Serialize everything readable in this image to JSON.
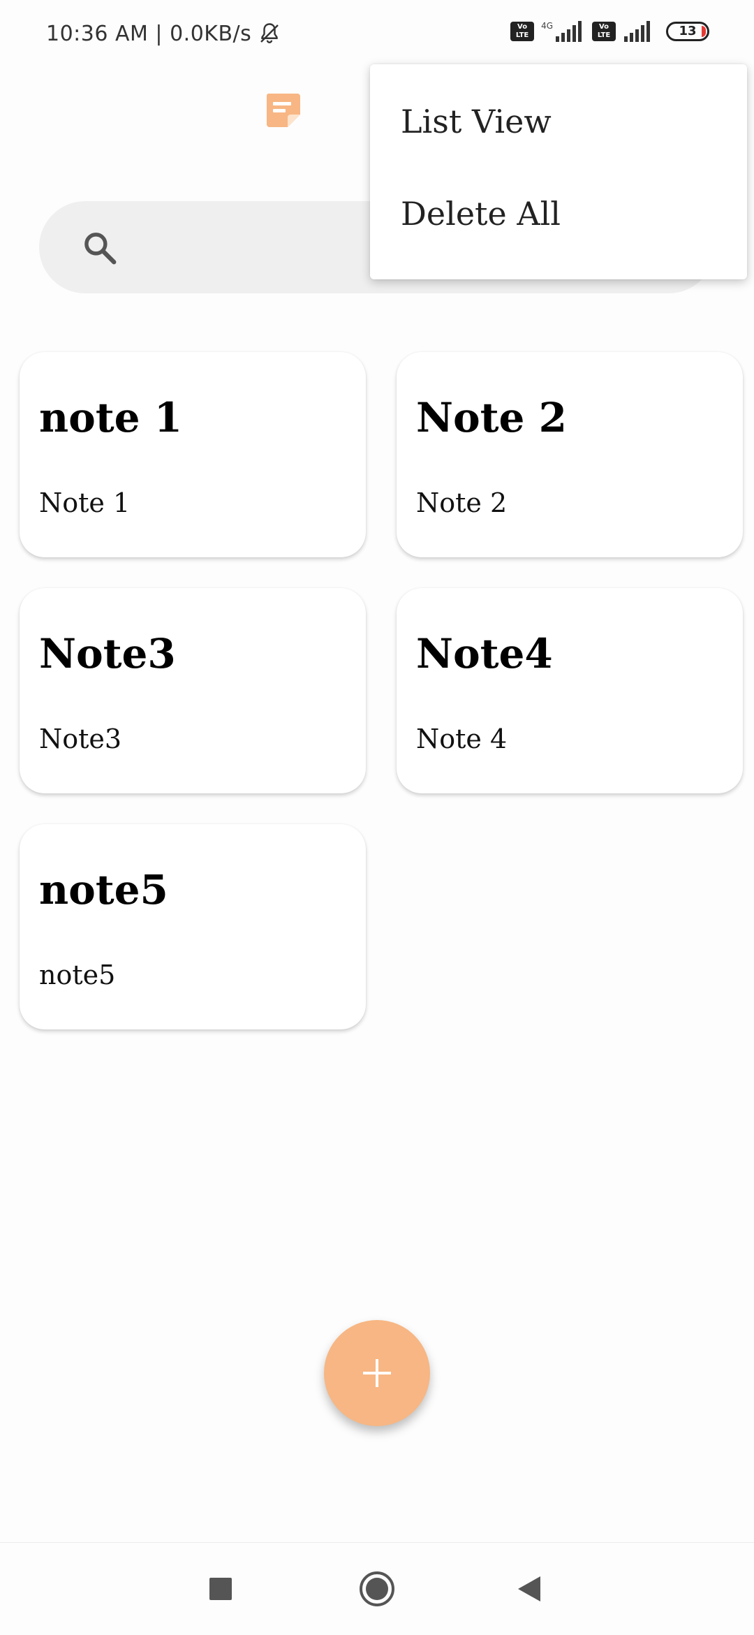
{
  "status_bar": {
    "left_text": "10:36 AM | 0.0KB/s",
    "volte_label": "Vo\nLTE",
    "network_label": "4G",
    "battery_level": "13"
  },
  "search": {
    "placeholder": ""
  },
  "notes": [
    {
      "title": "note 1",
      "body": "Note 1"
    },
    {
      "title": "Note 2",
      "body": "Note 2"
    },
    {
      "title": "Note3",
      "body": "Note3"
    },
    {
      "title": "Note4",
      "body": "Note 4"
    },
    {
      "title": "note5",
      "body": "note5"
    }
  ],
  "menu": {
    "items": [
      "List View",
      "Delete All"
    ]
  },
  "colors": {
    "accent": "#f7b683",
    "background": "#fdfdfd",
    "card": "#ffffff",
    "search_bg": "#efefef"
  },
  "icons": {
    "logo": "sticky-note-icon",
    "search": "search-icon",
    "fab": "plus-icon",
    "nav": [
      "recents-square-icon",
      "home-circle-icon",
      "back-triangle-icon"
    ]
  }
}
